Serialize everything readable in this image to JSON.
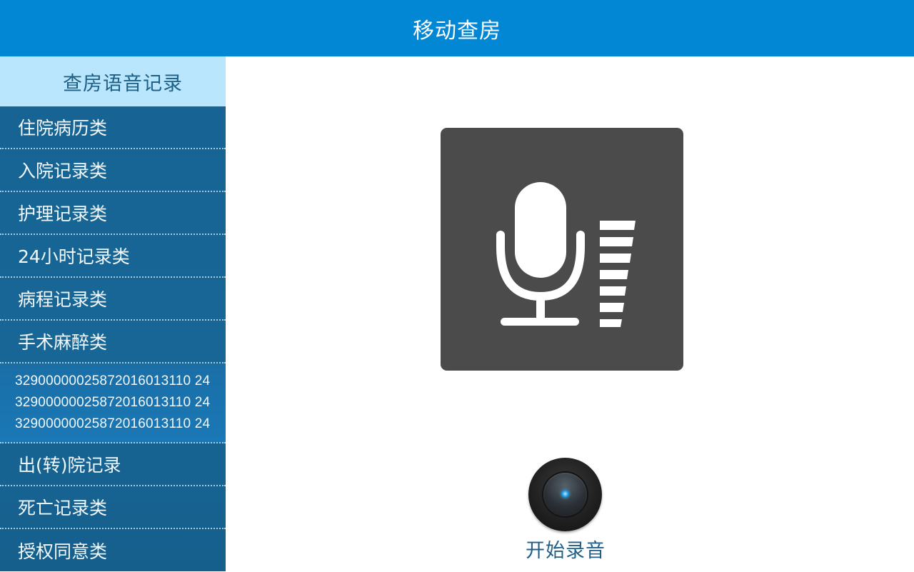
{
  "header": {
    "title": "移动查房"
  },
  "sidebar": {
    "header": "查房语音记录",
    "items": [
      {
        "label": "住院病历类"
      },
      {
        "label": "入院记录类"
      },
      {
        "label": "护理记录类"
      },
      {
        "label": "24小时记录类"
      },
      {
        "label": "病程记录类"
      },
      {
        "label": "手术麻醉类"
      },
      {
        "lines": [
          "32900000025872016013110 24",
          "32900000025872016013110 24",
          "32900000025872016013110 24"
        ]
      },
      {
        "label": "出(转)院记录"
      },
      {
        "label": "死亡记录类"
      },
      {
        "label": "授权同意类"
      }
    ]
  },
  "main": {
    "mic_icon": "microphone-with-level-meter-icon",
    "record_button_icon": "record-knob-icon",
    "record_label": "开始录音"
  },
  "colors": {
    "header_bg": "#0287d4",
    "sidebar_bg": "#176493",
    "sidebar_header_bg": "#b9e6fc",
    "mic_panel_bg": "#4b4b4b",
    "record_label": "#1f5f8a"
  }
}
